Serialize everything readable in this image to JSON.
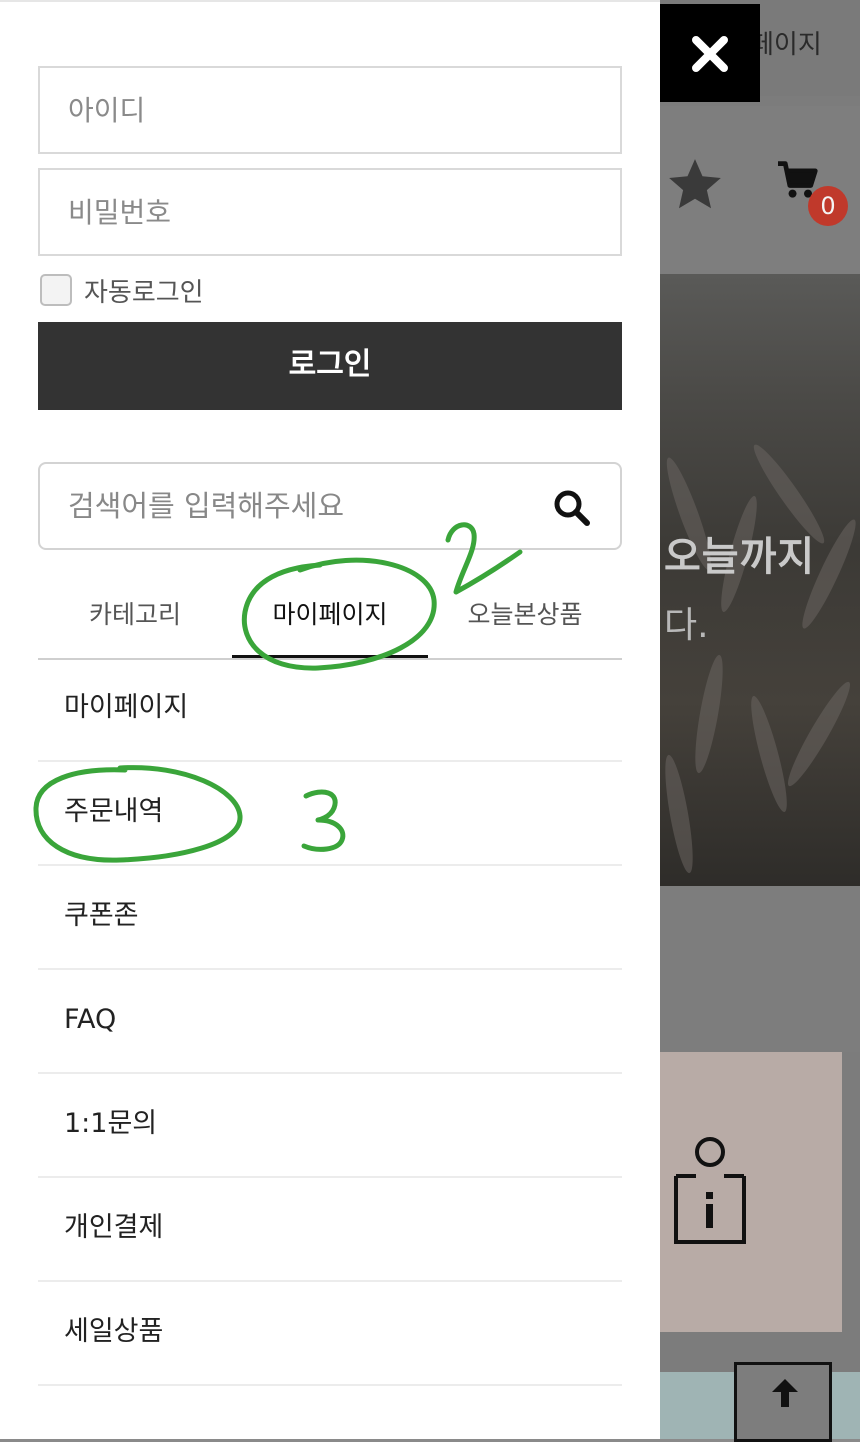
{
  "background_page": {
    "top_label": "페이지",
    "cart_count": "0",
    "hero_line1": "오늘까지",
    "hero_line2": "다."
  },
  "login": {
    "id_placeholder": "아이디",
    "password_placeholder": "비밀번호",
    "auto_login_label": "자동로그인",
    "login_button_label": "로그인"
  },
  "search": {
    "placeholder": "검색어를 입력해주세요"
  },
  "tabs": [
    {
      "label": "카테고리"
    },
    {
      "label": "마이페이지",
      "active": true
    },
    {
      "label": "오늘본상품"
    }
  ],
  "menu": [
    {
      "label": "마이페이지"
    },
    {
      "label": "주문내역"
    },
    {
      "label": "쿠폰존"
    },
    {
      "label": "FAQ"
    },
    {
      "label": "1:1문의"
    },
    {
      "label": "개인결제"
    },
    {
      "label": "세일상품"
    }
  ],
  "annotations": {
    "number_2": "2",
    "number_3": "3",
    "color": "#3aa53a"
  },
  "colors": {
    "login_button": "#333333",
    "badge": "#c0392b",
    "drawer_background": "#ffffff",
    "overlay": "#7c7c7c"
  }
}
